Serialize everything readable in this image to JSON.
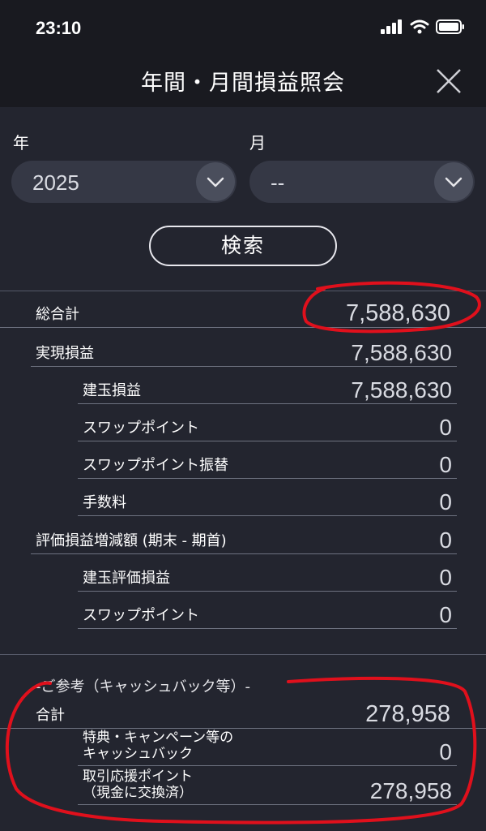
{
  "status_bar": {
    "time": "23:10"
  },
  "header": {
    "title": "年間・月間損益照会"
  },
  "filters": {
    "year_label": "年",
    "year_value": "2025",
    "month_label": "月",
    "month_value": "--",
    "search_label": "検索"
  },
  "summary": {
    "grand_total_label": "総合計",
    "grand_total_value": "7,588,630",
    "rows": [
      {
        "label": "実現損益",
        "value": "7,588,630"
      },
      {
        "label": "建玉損益",
        "value": "7,588,630"
      },
      {
        "label": "スワップポイント",
        "value": "0"
      },
      {
        "label": "スワップポイント振替",
        "value": "0"
      },
      {
        "label": "手数料",
        "value": "0"
      },
      {
        "label": "評価損益増減額 (期末 - 期首)",
        "value": "0"
      },
      {
        "label": "建玉評価損益",
        "value": "0"
      },
      {
        "label": "スワップポイント",
        "value": "0"
      }
    ]
  },
  "reference": {
    "title": "-ご参考（キャッシュバック等）-",
    "total_label": "合計",
    "total_value": "278,958",
    "rows": [
      {
        "label_line1": "特典・キャンペーン等の",
        "label_line2": "キャッシュバック",
        "value": "0"
      },
      {
        "label_line1": "取引応援ポイント",
        "label_line2": "（現金に交換済）",
        "value": "278,958"
      }
    ]
  },
  "colors": {
    "background": "#23252f",
    "header": "#191a20",
    "annotation": "#e0101c"
  }
}
